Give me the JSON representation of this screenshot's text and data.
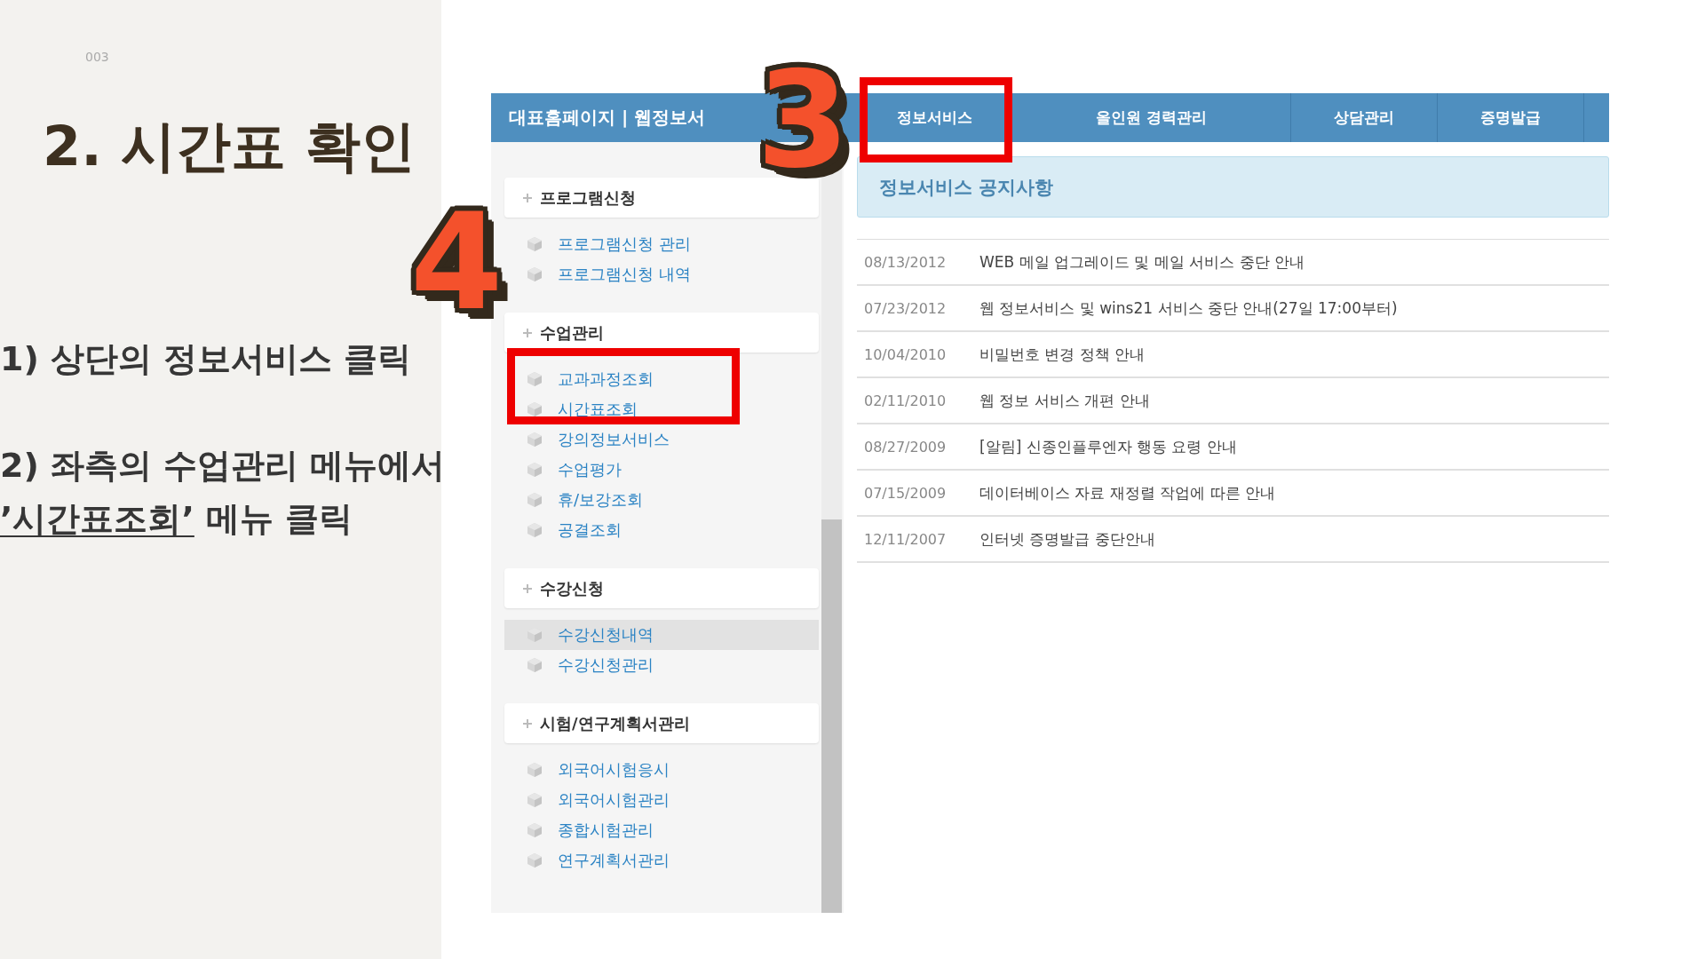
{
  "slide": {
    "page_number": "003",
    "title": "2. 시간표 확인",
    "steps": [
      {
        "lines": [
          [
            {
              "text": "1) 상단의 정보서비스 클릭",
              "underlined": false
            }
          ]
        ]
      },
      {
        "lines": [
          [
            {
              "text": "2) 좌측의 수업관리 메뉴에서",
              "underlined": false
            }
          ],
          [
            {
              "text": "’시간표조회’",
              "underlined": true
            },
            {
              "text": " 메뉴 클릭",
              "underlined": false
            }
          ]
        ]
      }
    ]
  },
  "portal": {
    "site_title": "대표홈페이지 | 웹정보서",
    "nav_tabs": [
      {
        "label": "정보서비스"
      },
      {
        "label": "올인원 경력관리"
      },
      {
        "label": "상담관리"
      },
      {
        "label": "증명발급"
      }
    ],
    "sidebar": {
      "groups": [
        {
          "title": "프로그램신청",
          "items": [
            {
              "label": "프로그램신청 관리",
              "selected": false
            },
            {
              "label": "프로그램신청 내역",
              "selected": false
            }
          ]
        },
        {
          "title": "수업관리",
          "items": [
            {
              "label": "교과과정조회",
              "selected": false
            },
            {
              "label": "시간표조회",
              "selected": false
            },
            {
              "label": "강의정보서비스",
              "selected": false
            },
            {
              "label": "수업평가",
              "selected": false
            },
            {
              "label": "휴/보강조회",
              "selected": false
            },
            {
              "label": "공결조회",
              "selected": false
            }
          ]
        },
        {
          "title": "수강신청",
          "items": [
            {
              "label": "수강신청내역",
              "selected": true
            },
            {
              "label": "수강신청관리",
              "selected": false
            }
          ]
        },
        {
          "title": "시험/연구계획서관리",
          "items": [
            {
              "label": "외국어시험응시",
              "selected": false
            },
            {
              "label": "외국어시험관리",
              "selected": false
            },
            {
              "label": "종합시험관리",
              "selected": false
            },
            {
              "label": "연구계획서관리",
              "selected": false
            }
          ]
        }
      ]
    },
    "notice_board": {
      "title": "정보서비스 공지사항",
      "rows": [
        {
          "date": "08/13/2012",
          "title": "WEB 메일 업그레이드 및 메일 서비스 중단 안내"
        },
        {
          "date": "07/23/2012",
          "title": "웹 정보서비스 및 wins21 서비스 중단 안내(27일 17:00부터)"
        },
        {
          "date": "10/04/2010",
          "title": "비밀번호 변경 정책 안내"
        },
        {
          "date": "02/11/2010",
          "title": "웹 정보 서비스 개편 안내"
        },
        {
          "date": "08/27/2009",
          "title": "[알림] 신종인플루엔자 행동 요령 안내"
        },
        {
          "date": "07/15/2009",
          "title": "데이터베이스 자료 재정렬 작업에 따른 안내"
        },
        {
          "date": "12/11/2007",
          "title": "인터넷 증명발급 중단안내"
        }
      ]
    }
  },
  "annotations": [
    {
      "kind": "highlight-box"
    },
    {
      "kind": "highlight-box"
    },
    {
      "kind": "step-number",
      "label": "3"
    },
    {
      "kind": "step-number",
      "label": "4"
    }
  ]
}
